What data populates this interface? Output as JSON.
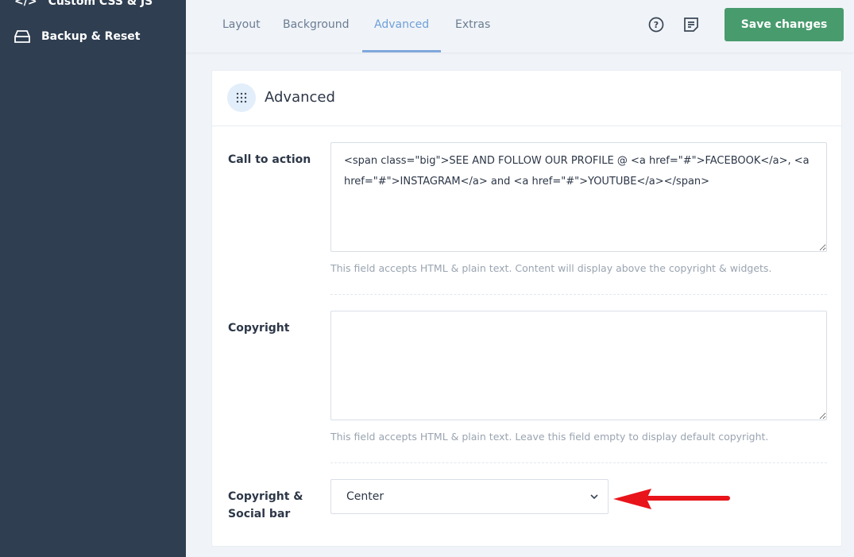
{
  "sidebar": {
    "items": [
      {
        "label": "Custom CSS & JS",
        "icon": "code-icon"
      },
      {
        "label": "Backup & Reset",
        "icon": "drive-icon"
      }
    ]
  },
  "header": {
    "tabs": [
      {
        "label": "Layout"
      },
      {
        "label": "Background"
      },
      {
        "label": "Advanced",
        "active": true
      },
      {
        "label": "Extras"
      }
    ],
    "save_label": "Save changes"
  },
  "card": {
    "title": "Advanced",
    "call_to_action": {
      "label": "Call to action",
      "value": "<span class=\"big\">SEE AND FOLLOW OUR PROFILE @ <a href=\"#\">FACEBOOK</a>, <a href=\"#\">INSTAGRAM</a> and <a href=\"#\">YOUTUBE</a></span>",
      "help": "This field accepts HTML & plain text. Content will display above the copyright & widgets."
    },
    "copyright": {
      "label": "Copyright",
      "value": "",
      "help": "This field accepts HTML & plain text. Leave this field empty to display default copyright."
    },
    "social_bar": {
      "label": "Copyright & Social bar",
      "value": "Center"
    }
  },
  "colors": {
    "sidebar": "#2f3e50",
    "accent": "#6f9fd8",
    "save": "#489b6d",
    "arrow": "#e8141a"
  }
}
